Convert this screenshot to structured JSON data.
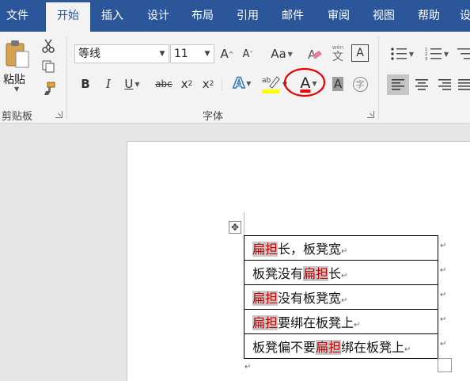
{
  "tabs": [
    {
      "label": "文件",
      "active": false
    },
    {
      "label": "开始",
      "active": true
    },
    {
      "label": "插入",
      "active": false
    },
    {
      "label": "设计",
      "active": false
    },
    {
      "label": "布局",
      "active": false
    },
    {
      "label": "引用",
      "active": false
    },
    {
      "label": "邮件",
      "active": false
    },
    {
      "label": "审阅",
      "active": false
    },
    {
      "label": "视图",
      "active": false
    },
    {
      "label": "帮助",
      "active": false
    },
    {
      "label": "设",
      "active": false
    }
  ],
  "clipboard": {
    "paste_label": "粘贴",
    "group_label": "剪贴板"
  },
  "font": {
    "font_name": "等线",
    "font_size": "11",
    "group_label": "字体",
    "grow_label": "A",
    "shrink_label": "A",
    "case_label": "Aa",
    "bold_label": "B",
    "italic_label": "I",
    "underline_label": "U",
    "strike_label": "abc",
    "subscript_label": "x",
    "superscript_label": "x",
    "effects_label": "A",
    "color_label": "A",
    "shade_label": "A",
    "phonetic_label": "文",
    "border_label": "A",
    "enclose_label": "字",
    "highlight_color": "#ffff00",
    "font_color": "#ff0000",
    "callout_color": "#e60000"
  },
  "table_rows": [
    {
      "before": "",
      "highlight": "扁担",
      "after": "长，板凳宽"
    },
    {
      "before": "板凳没有",
      "highlight": "扁担",
      "after": "长"
    },
    {
      "before": "",
      "highlight": "扁担",
      "after": "没有板凳宽"
    },
    {
      "before": "",
      "highlight": "扁担",
      "after": "要绑在板凳上"
    },
    {
      "before": "板凳偏不要",
      "highlight": "扁担",
      "after": "绑在板凳上"
    }
  ],
  "marks": {
    "paragraph": "↵",
    "move_handle": "✥"
  }
}
